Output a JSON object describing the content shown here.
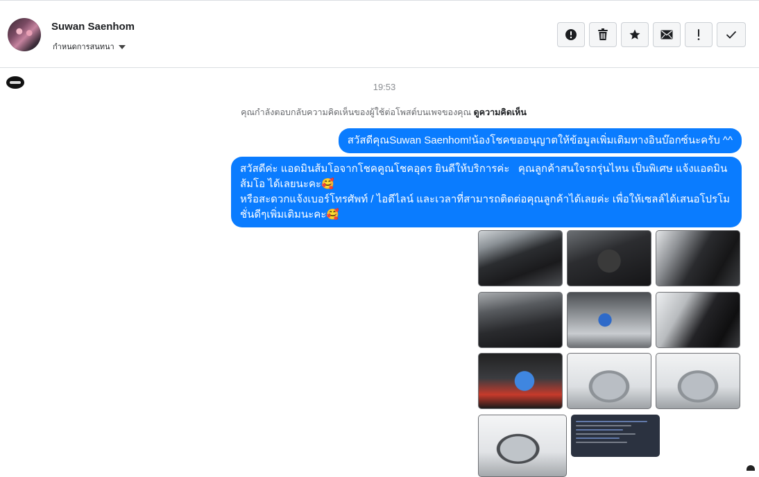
{
  "header": {
    "name": "Suwan Saenhom",
    "subtitle": "กำหนดการสนทนา",
    "actions": [
      {
        "icon": "alert-circle-icon"
      },
      {
        "icon": "trash-icon"
      },
      {
        "icon": "star-icon"
      },
      {
        "icon": "envelope-icon"
      },
      {
        "icon": "exclamation-icon"
      },
      {
        "icon": "check-icon"
      }
    ]
  },
  "conversation": {
    "time": "19:53",
    "context_text": "คุณกำลังตอบกลับความคิดเห็นของผู้ใช้ต่อโพสต์บนเพจของคุณ",
    "context_link": "ดูความคิดเห็น",
    "messages": [
      {
        "text": "สวัสดีคุณSuwan Saenhom!น้องโชคขออนุญาตให้ข้อมูลเพิ่มเติมทางอินบ๊อกซ์นะครับ ^^"
      },
      {
        "text": "สวัสดีค่ะ แอดมินส้มโอจากโชคคูณโชคอุดร ยินดีให้บริการค่ะ   คุณลูกค้าสนใจรถรุ่นไหน เป็นพิเศษ แจ้งแอดมินส้มโอ ได้เลยนะคะ🥰\nหรือสะดวกแจ้งเบอร์โทรศัพท์ / ไอดีไลน์ และเวลาที่สามารถติดต่อคุณลูกค้าได้เลยค่ะ เพื่อให้เซลล์ได้เสนอโปรโมชั่นดีๆเพิ่มเติมนะคะ🥰"
      }
    ],
    "photos": [
      "interior-1",
      "interior-2",
      "interior-3",
      "dashboard",
      "engine",
      "rear-seats",
      "battery",
      "truck-front-1",
      "truck-front-2",
      "truck-rear",
      "document-screenshot"
    ]
  },
  "colors": {
    "bubble": "#0a7cff",
    "divider": "#dadde1"
  }
}
